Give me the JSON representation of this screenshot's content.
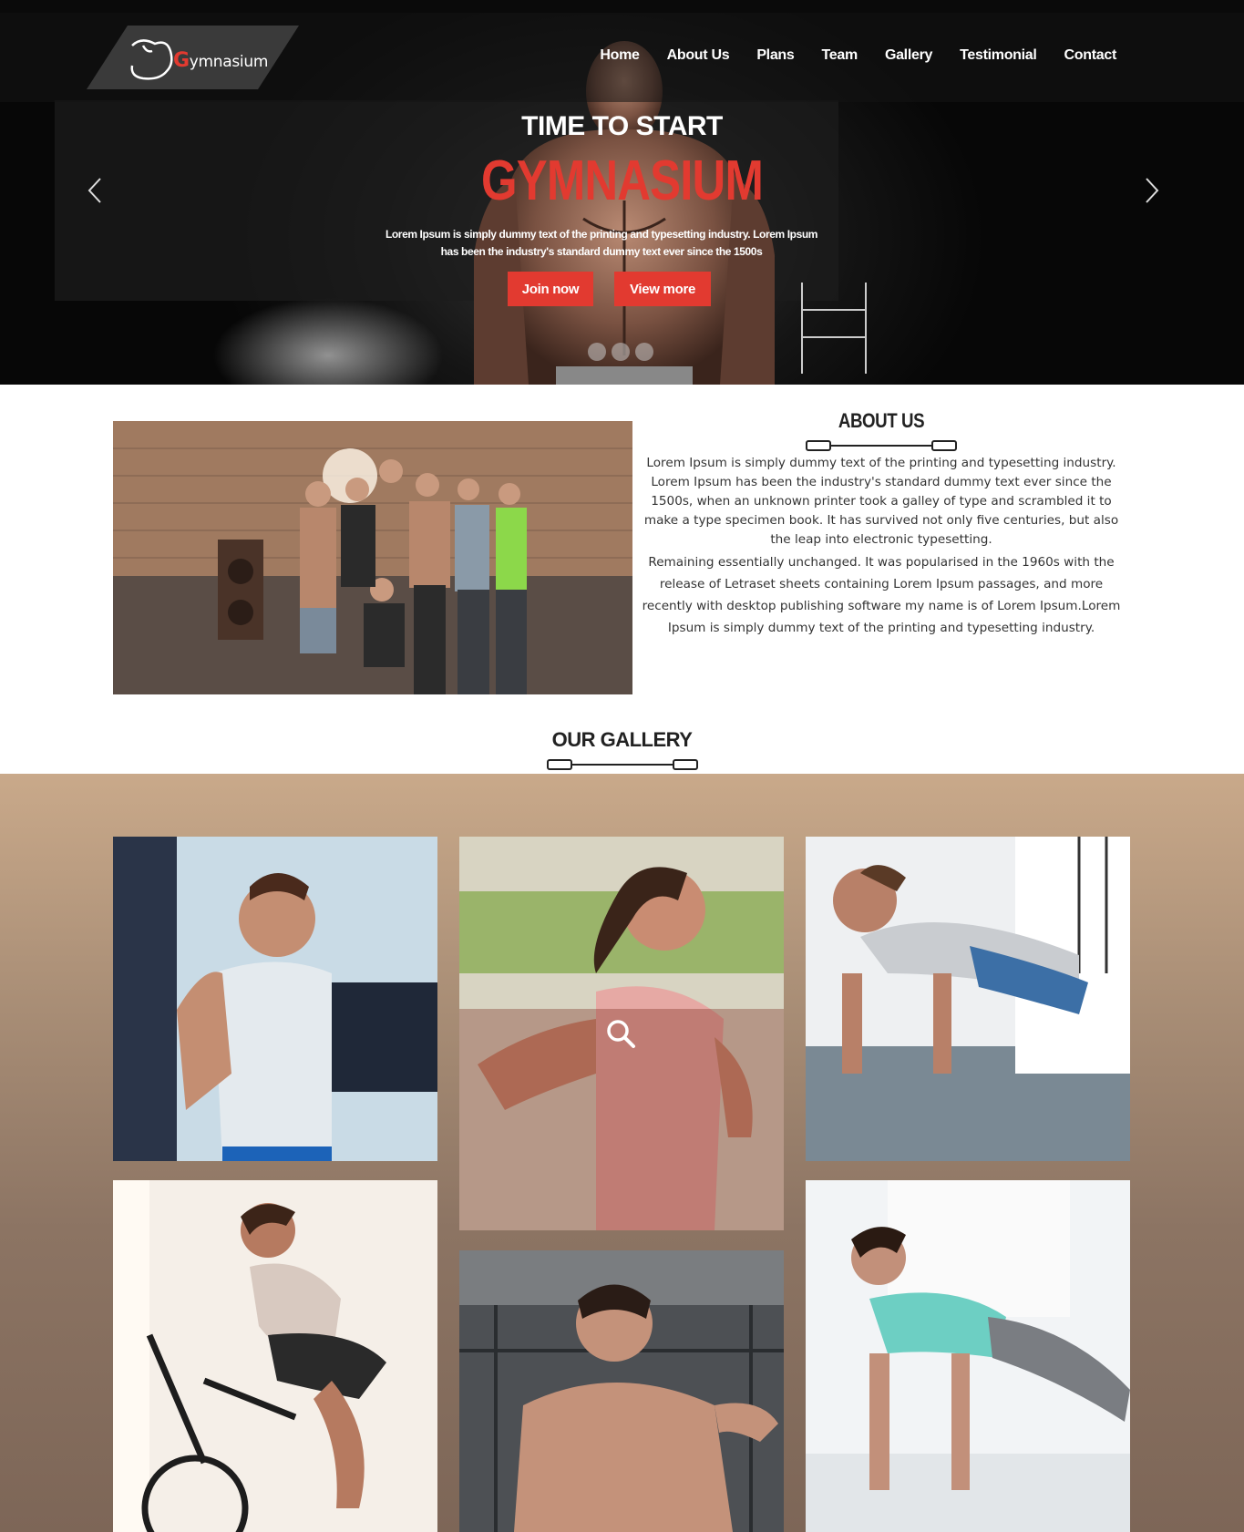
{
  "brand": {
    "name_rest": "ymnasium",
    "name_initial": "G"
  },
  "nav": {
    "items": [
      {
        "label": "Home"
      },
      {
        "label": "About Us"
      },
      {
        "label": "Plans"
      },
      {
        "label": "Team"
      },
      {
        "label": "Gallery"
      },
      {
        "label": "Testimonial"
      },
      {
        "label": "Contact"
      }
    ]
  },
  "hero": {
    "subtitle": "TIME TO START",
    "title": "GYMNASIUM",
    "text": "Lorem Ipsum is simply dummy text of the printing and typesetting industry. Lorem Ipsum has been the industry's standard dummy text ever since the 1500s",
    "join_label": "Join now",
    "more_label": "View more",
    "slides_count": 3
  },
  "about": {
    "title": "ABOUT US",
    "p1": "Lorem Ipsum is simply dummy text of the printing and typesetting industry. Lorem Ipsum has been the industry's standard dummy text ever since the 1500s, when an unknown printer took a galley of type and scrambled it to make a type specimen book. It has survived not only five centuries, but also the leap into electronic typesetting.",
    "p2": "Remaining essentially unchanged. It was popularised in the 1960s with the release of Letraset sheets containing Lorem Ipsum passages, and more recently with desktop publishing software my name is of Lorem Ipsum.Lorem Ipsum is simply dummy text of the printing and typesetting industry."
  },
  "gallery": {
    "title": "OUR GALLERY"
  },
  "colors": {
    "accent": "#e23a30",
    "dark": "#111111",
    "text": "#333333"
  },
  "icons": [
    "chevron-left-icon",
    "chevron-right-icon",
    "search-icon",
    "dumbbell-divider-icon",
    "flexing-arm-icon"
  ]
}
